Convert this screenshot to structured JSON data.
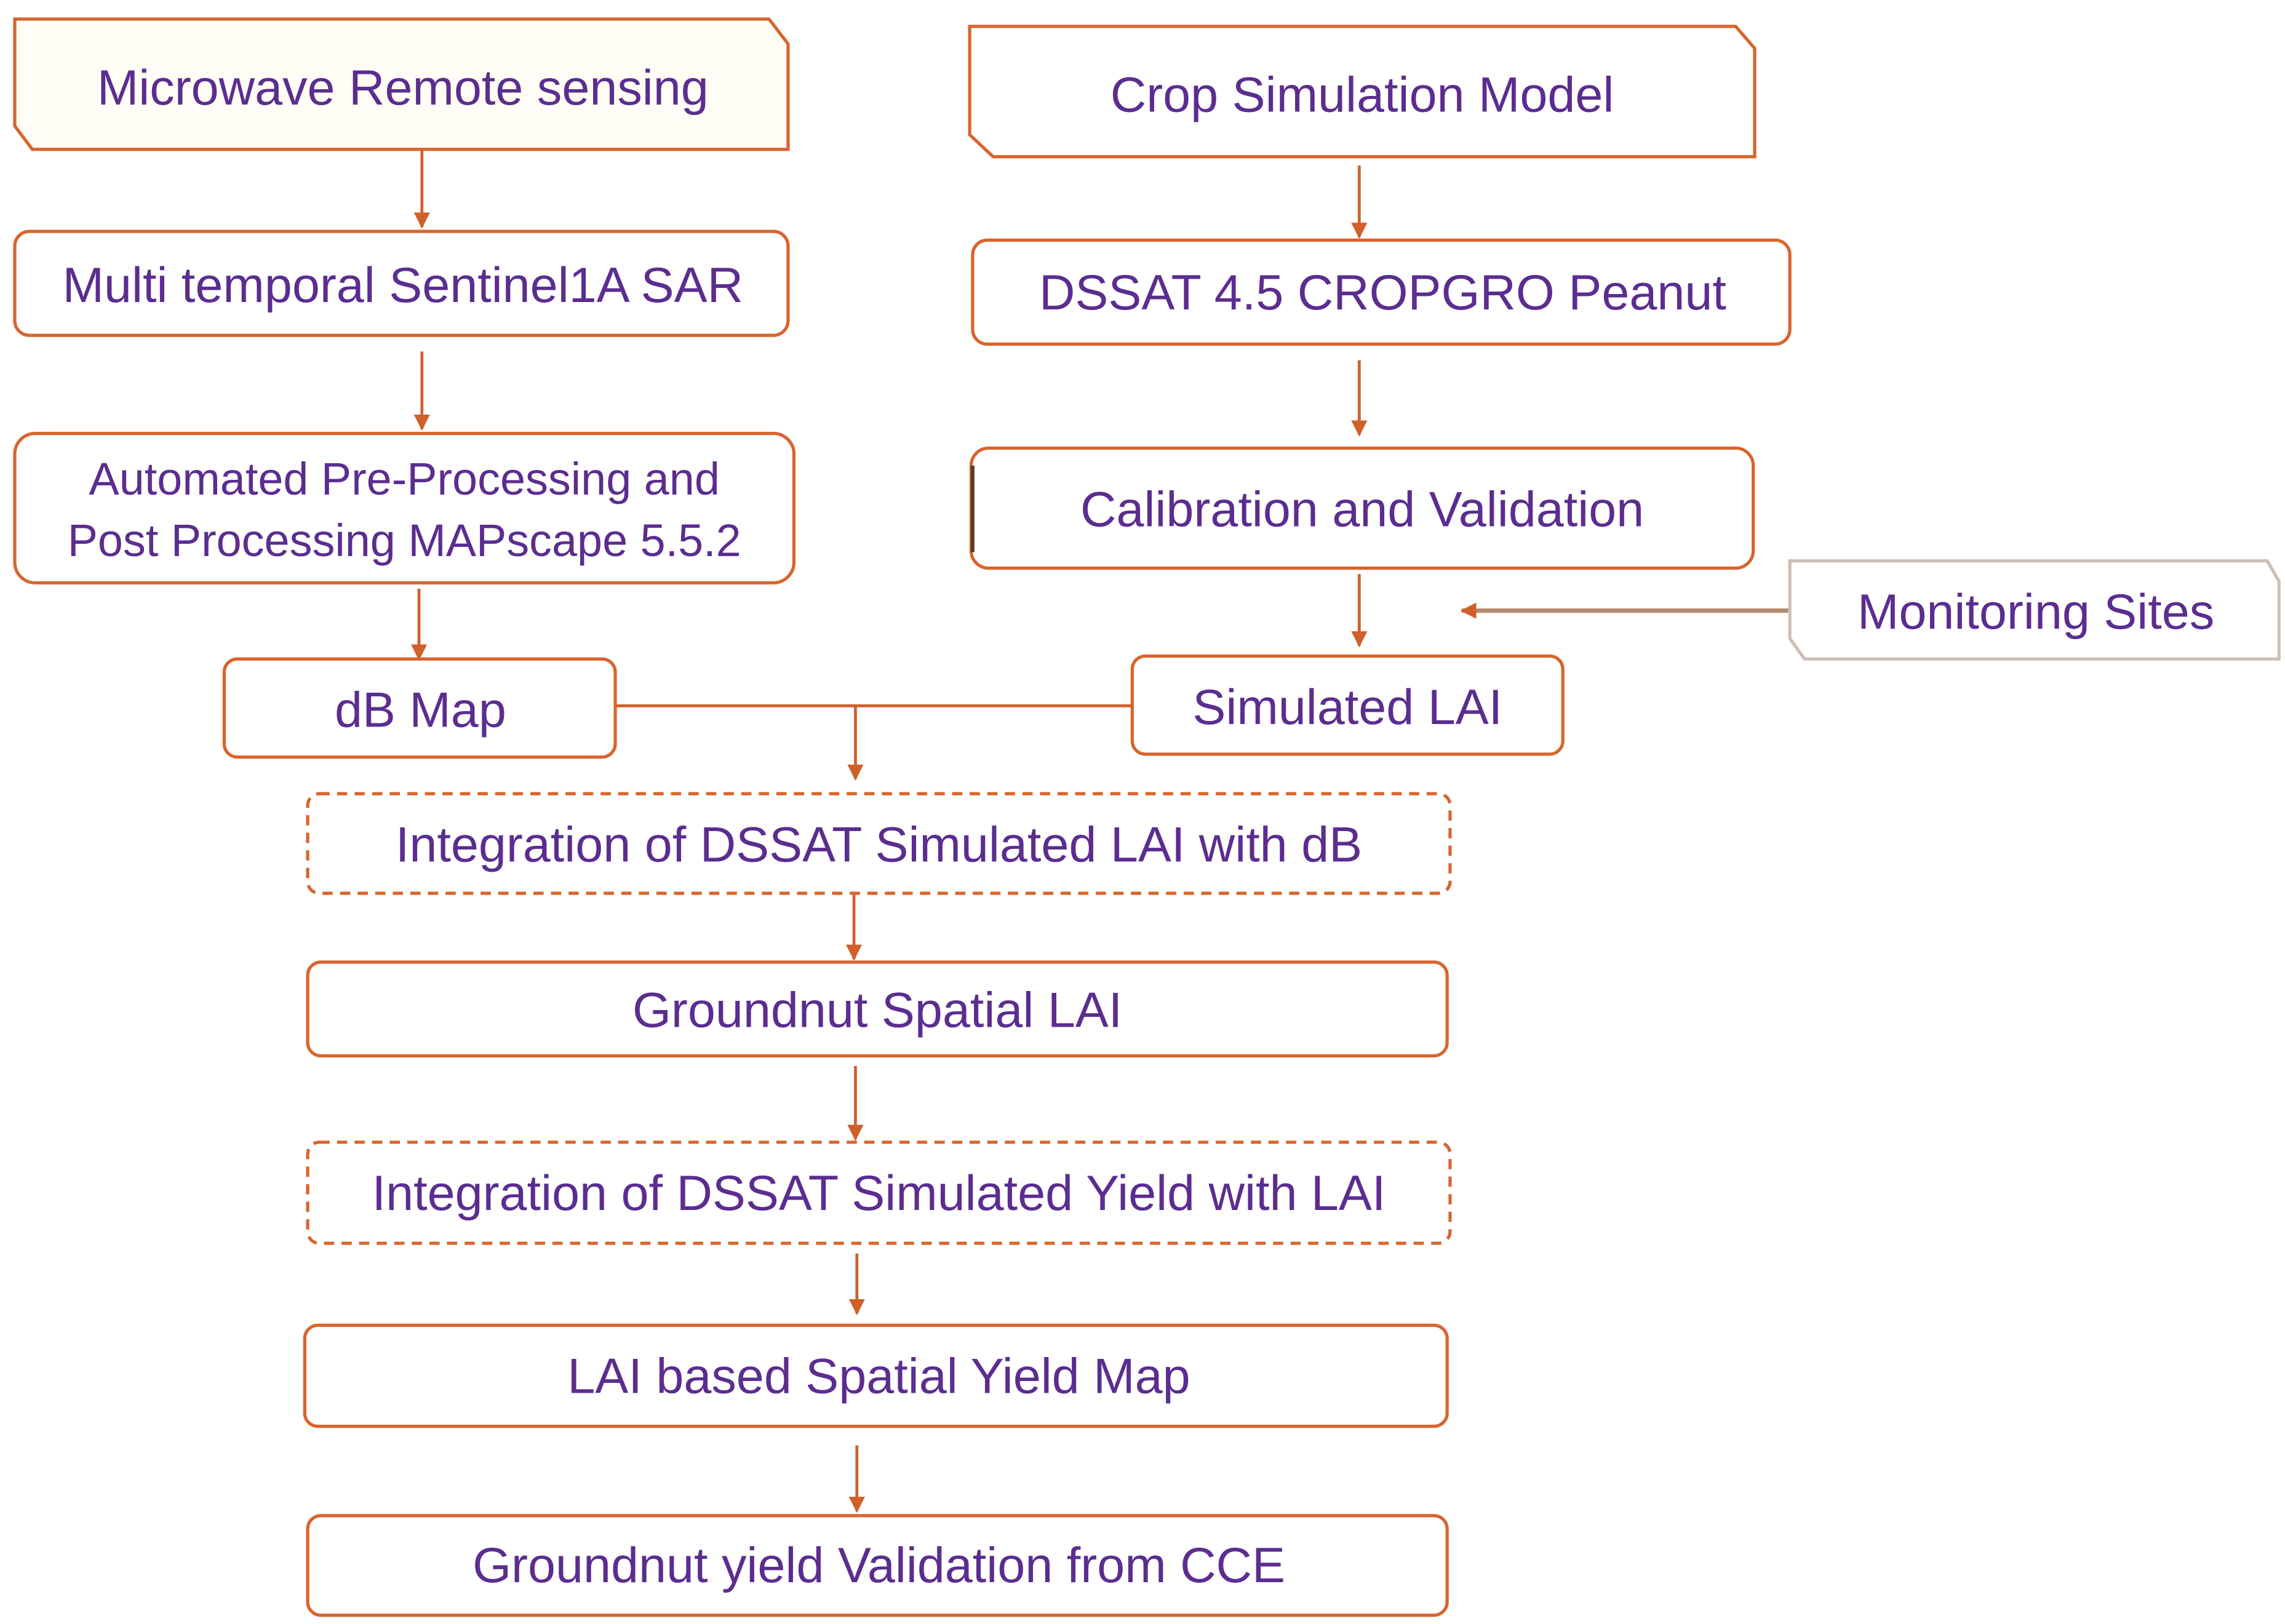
{
  "colors": {
    "text": "#5b2d90",
    "border": "#d8652e",
    "arrow": "#d0602a"
  },
  "left": {
    "microwave": "Microwave Remote sensing",
    "sentinel": "Multi temporal Sentinel1A SAR",
    "processing_line1": "Automated Pre-Processing and",
    "processing_line2": "Post  Processing MAPscape 5.5.2",
    "db_map": "dB Map"
  },
  "right": {
    "crop_model": "Crop Simulation Model",
    "dssat": "DSSAT 4.5 CROPGRO Peanut",
    "calibration": "Calibration and Validation",
    "monitoring": "Monitoring Sites",
    "simulated_lai": "Simulated LAI"
  },
  "center": {
    "integration_db": "Integration of DSSAT Simulated LAI with dB",
    "spatial_lai": "Groundnut Spatial LAI",
    "integration_yield": "Integration of DSSAT Simulated Yield with LAI",
    "yield_map": "LAI based Spatial Yield Map",
    "validation": "Groundnut yield Validation from CCE"
  }
}
